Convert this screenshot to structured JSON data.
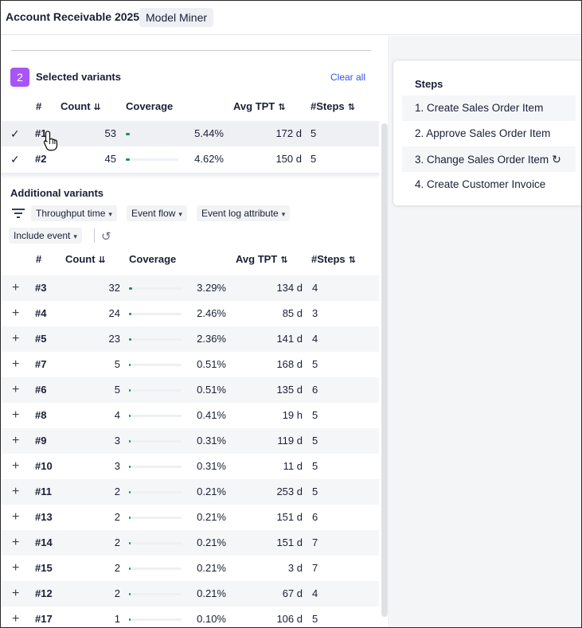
{
  "header": {
    "title": "Account Receivable 2025",
    "mode": "Model Miner"
  },
  "selected": {
    "count_badge": "2",
    "title": "Selected variants",
    "clear_label": "Clear all",
    "columns": {
      "num": "#",
      "count": "Count",
      "coverage": "Coverage",
      "avg_tpt": "Avg TPT",
      "steps": "#Steps"
    },
    "rows": [
      {
        "num": "#1",
        "count": "53",
        "coverage": "5.44%",
        "coverage_value": 5.44,
        "tpt": "172 d",
        "steps": "5"
      },
      {
        "num": "#2",
        "count": "45",
        "coverage": "4.62%",
        "coverage_value": 4.62,
        "tpt": "150 d",
        "steps": "5"
      }
    ]
  },
  "additional": {
    "title": "Additional variants",
    "filters": [
      "Throughput time",
      "Event flow",
      "Event log attribute",
      "Include event"
    ],
    "columns": {
      "num": "#",
      "count": "Count",
      "coverage": "Coverage",
      "avg_tpt": "Avg TPT",
      "steps": "#Steps"
    },
    "rows": [
      {
        "num": "#3",
        "count": "32",
        "coverage": "3.29%",
        "coverage_value": 3.29,
        "tpt": "134 d",
        "steps": "4"
      },
      {
        "num": "#4",
        "count": "24",
        "coverage": "2.46%",
        "coverage_value": 2.46,
        "tpt": "85 d",
        "steps": "3"
      },
      {
        "num": "#5",
        "count": "23",
        "coverage": "2.36%",
        "coverage_value": 2.36,
        "tpt": "141 d",
        "steps": "4"
      },
      {
        "num": "#7",
        "count": "5",
        "coverage": "0.51%",
        "coverage_value": 0.51,
        "tpt": "168 d",
        "steps": "5"
      },
      {
        "num": "#6",
        "count": "5",
        "coverage": "0.51%",
        "coverage_value": 0.51,
        "tpt": "135 d",
        "steps": "6"
      },
      {
        "num": "#8",
        "count": "4",
        "coverage": "0.41%",
        "coverage_value": 0.41,
        "tpt": "19 h",
        "steps": "5"
      },
      {
        "num": "#9",
        "count": "3",
        "coverage": "0.31%",
        "coverage_value": 0.31,
        "tpt": "119 d",
        "steps": "5"
      },
      {
        "num": "#10",
        "count": "3",
        "coverage": "0.31%",
        "coverage_value": 0.31,
        "tpt": "11 d",
        "steps": "5"
      },
      {
        "num": "#11",
        "count": "2",
        "coverage": "0.21%",
        "coverage_value": 0.21,
        "tpt": "253 d",
        "steps": "5"
      },
      {
        "num": "#13",
        "count": "2",
        "coverage": "0.21%",
        "coverage_value": 0.21,
        "tpt": "151 d",
        "steps": "6"
      },
      {
        "num": "#14",
        "count": "2",
        "coverage": "0.21%",
        "coverage_value": 0.21,
        "tpt": "151 d",
        "steps": "7"
      },
      {
        "num": "#15",
        "count": "2",
        "coverage": "0.21%",
        "coverage_value": 0.21,
        "tpt": "3 d",
        "steps": "7"
      },
      {
        "num": "#12",
        "count": "2",
        "coverage": "0.21%",
        "coverage_value": 0.21,
        "tpt": "67 d",
        "steps": "4"
      },
      {
        "num": "#17",
        "count": "1",
        "coverage": "0.10%",
        "coverage_value": 0.1,
        "tpt": "106 d",
        "steps": "5"
      }
    ]
  },
  "steps": {
    "title": "Steps",
    "items": [
      "1. Create Sales Order Item",
      "2. Approve Sales Order Item",
      "3. Change Sales Order Item",
      "4. Create Customer Invoice"
    ]
  },
  "colors": {
    "accent": "#a855f7",
    "link": "#2f54eb",
    "coverage_bar": "#1f8a5b"
  }
}
